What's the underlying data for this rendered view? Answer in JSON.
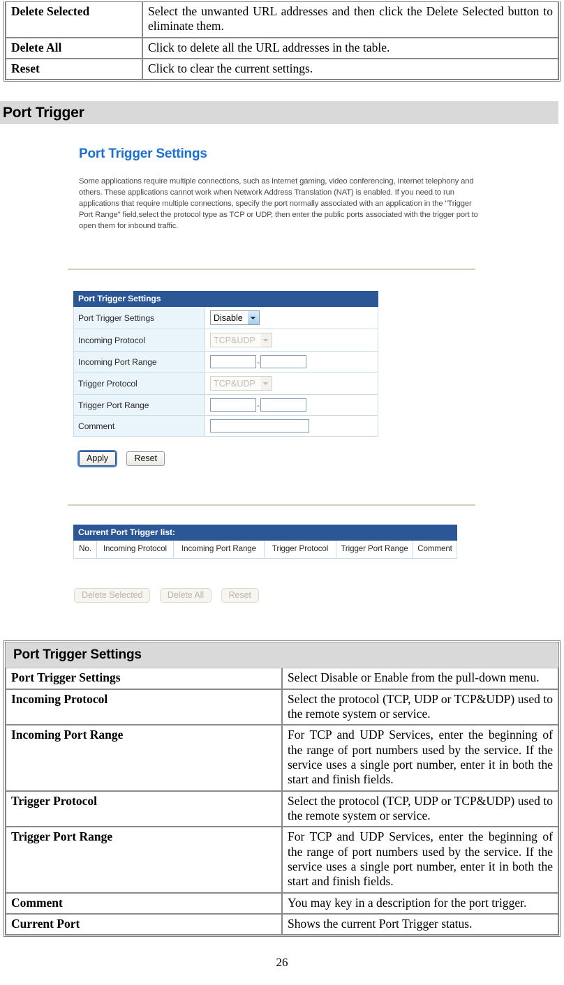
{
  "top_table": {
    "rows": [
      {
        "label": "Delete Selected",
        "desc": "Select the unwanted URL addresses and then click the Delete Selected button to eliminate them."
      },
      {
        "label": "Delete All",
        "desc": "Click to delete all the URL addresses in the table."
      },
      {
        "label": "Reset",
        "desc": "Click to clear the current settings."
      }
    ]
  },
  "section": {
    "title": "Port Trigger"
  },
  "router_screenshot": {
    "page_title": "Port Trigger Settings",
    "description": "Some applications require multiple connections, such as Internet gaming, video conferencing, Internet telephony and others. These applications cannot work when Network Address Translation (NAT) is enabled. If you need to run applications that require multiple connections, specify the port normally associated with an application in the \"Trigger Port Range\" field,select the protocol type as TCP or UDP, then enter the public ports associated with the trigger port to open them for inbound traffic.",
    "settings_table": {
      "header": "Port Trigger Settings",
      "rows": [
        {
          "label": "Port Trigger Settings",
          "control": "select",
          "value": "Disable",
          "enabled": true
        },
        {
          "label": "Incoming Protocol",
          "control": "select",
          "value": "TCP&UDP",
          "enabled": false
        },
        {
          "label": "Incoming Port Range",
          "control": "port-range",
          "start": "",
          "end": "",
          "separator": "-"
        },
        {
          "label": "Trigger Protocol",
          "control": "select",
          "value": "TCP&UDP",
          "enabled": false
        },
        {
          "label": "Trigger Port Range",
          "control": "port-range",
          "start": "",
          "end": "",
          "separator": "-"
        },
        {
          "label": "Comment",
          "control": "text",
          "value": ""
        }
      ]
    },
    "form_buttons": {
      "apply": "Apply",
      "reset": "Reset"
    },
    "list_table": {
      "header": "Current Port Trigger list:",
      "columns": [
        "No.",
        "Incoming Protocol",
        "Incoming Port Range",
        "Trigger Protocol",
        "Trigger Port Range",
        "Comment"
      ],
      "rows": []
    },
    "list_buttons": {
      "delete_selected": "Delete Selected",
      "delete_all": "Delete All",
      "reset": "Reset"
    },
    "colors": {
      "table_header_blue": "#2c5796",
      "title_blue": "#1b6fd4",
      "label_cell": "#e9f5fb",
      "rule": "#d8cfbb"
    }
  },
  "bottom_table": {
    "title": "Port Trigger Settings",
    "rows": [
      {
        "label": "Port Trigger Settings",
        "desc": "Select Disable or Enable from the pull-down menu."
      },
      {
        "label": "Incoming Protocol",
        "desc": "Select the protocol (TCP, UDP or TCP&UDP) used to the remote system or service."
      },
      {
        "label": "Incoming Port Range",
        "desc": "For TCP and UDP Services, enter the beginning of the range of port numbers used by the service. If the service uses a single port number, enter it in both the start and finish fields."
      },
      {
        "label": "Trigger Protocol",
        "desc": "Select the protocol (TCP, UDP or TCP&UDP) used to the remote system or service."
      },
      {
        "label": "Trigger Port Range",
        "desc": "For TCP and UDP Services, enter the beginning of the range of port numbers used by the service. If the service uses a single port number, enter it in both the start and finish fields."
      },
      {
        "label": "Comment",
        "desc": "You may key in a description for the port trigger."
      },
      {
        "label": "Current Port",
        "desc": "Shows the current Port Trigger status."
      }
    ]
  },
  "footer": {
    "page_number": "26"
  }
}
